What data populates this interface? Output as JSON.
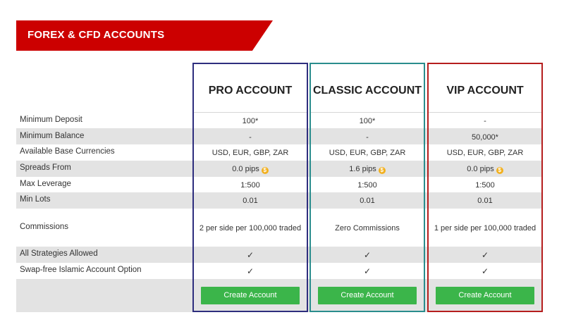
{
  "banner": {
    "title": "FOREX & CFD ACCOUNTS"
  },
  "colors": {
    "brand_red": "#cc0000",
    "pro_border": "#2e2e7e",
    "classic_border": "#2a8d8d",
    "vip_border": "#b51e1e",
    "button_green": "#3bb54a",
    "row_shade": "#e3e3e3"
  },
  "rows": [
    {
      "label": "Minimum Deposit"
    },
    {
      "label": "Minimum Balance"
    },
    {
      "label": "Available Base Currencies"
    },
    {
      "label": "Spreads From"
    },
    {
      "label": "Max Leverage"
    },
    {
      "label": "Min Lots"
    },
    {
      "label": "Commissions"
    },
    {
      "label": "All Strategies Allowed"
    },
    {
      "label": "Swap-free Islamic Account Option"
    }
  ],
  "accounts": [
    {
      "title": "PRO ACCOUNT",
      "values": [
        "100*",
        "-",
        "USD, EUR, GBP, ZAR",
        "0.0 pips",
        "1:500",
        "0.01",
        "2 per side per 100,000 traded",
        "✓",
        "✓"
      ],
      "button": "Create Account"
    },
    {
      "title": "CLASSIC ACCOUNT",
      "values": [
        "100*",
        "-",
        "USD, EUR, GBP, ZAR",
        "1.6 pips",
        "1:500",
        "0.01",
        "Zero Commissions",
        "✓",
        "✓"
      ],
      "button": "Create Account"
    },
    {
      "title": "VIP ACCOUNT",
      "values": [
        "-",
        "50,000*",
        "USD, EUR, GBP, ZAR",
        "0.0 pips",
        "1:500",
        "0.01",
        "1 per side per 100,000 traded",
        "✓",
        "✓"
      ],
      "button": "Create Account"
    }
  ],
  "icons": {
    "spread_info": "coin-info-icon",
    "checkmark": "checkmark-icon"
  }
}
